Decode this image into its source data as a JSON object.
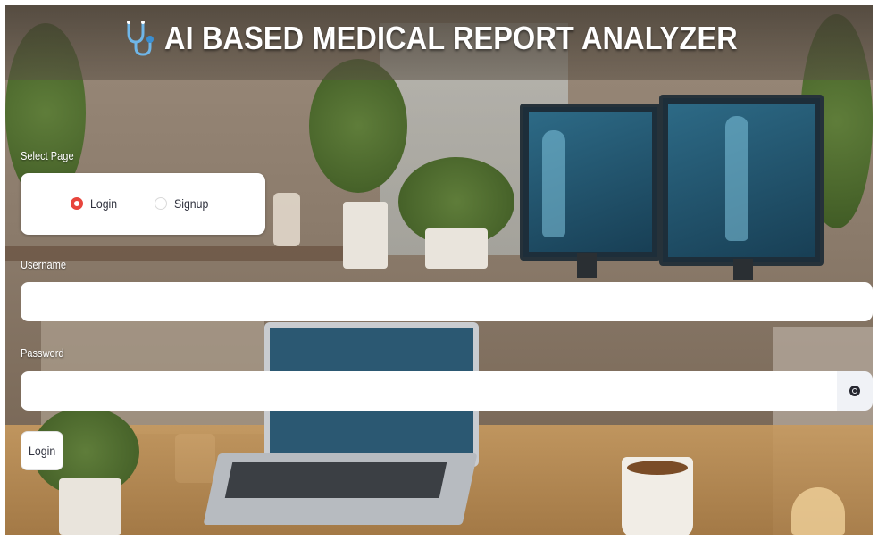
{
  "app": {
    "title": "AI BASED MEDICAL REPORT ANALYZER",
    "title_icon": "stethoscope-icon"
  },
  "page_select": {
    "label": "Select Page",
    "options": [
      {
        "label": "Login",
        "selected": true
      },
      {
        "label": "Signup",
        "selected": false
      }
    ]
  },
  "form": {
    "username_label": "Username",
    "username_value": "",
    "password_label": "Password",
    "password_value": "",
    "show_password_icon": "eye-icon",
    "submit_label": "Login"
  },
  "colors": {
    "radio_selected": "#e8453c",
    "title_text": "#ffffff",
    "field_background": "#ffffff",
    "text": "#31333f"
  }
}
